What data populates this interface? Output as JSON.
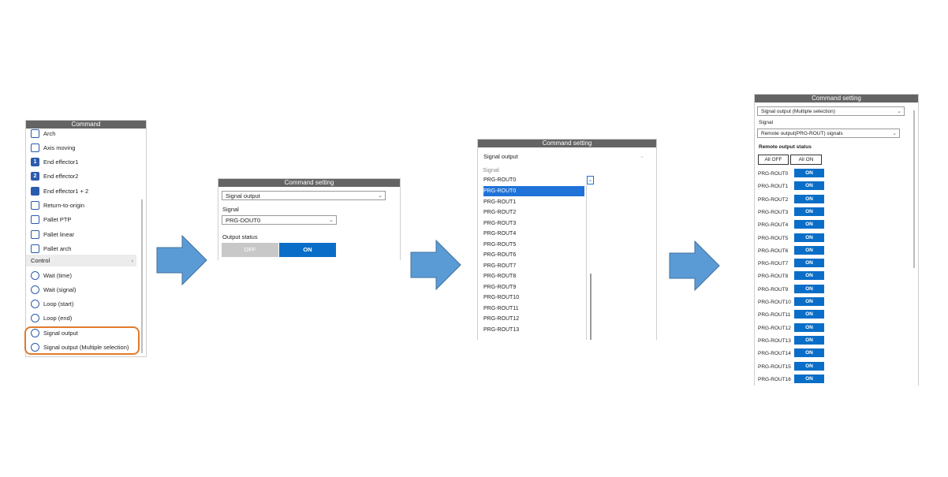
{
  "colors": {
    "accent": "#0a6ec8",
    "titlebar": "#646464",
    "arrow": "#5b9bd5",
    "highlight": "#e07b2c"
  },
  "panel1": {
    "title": "Command",
    "items": [
      {
        "label": "Arch",
        "icon": "arch-icon"
      },
      {
        "label": "Axis moving",
        "icon": "axis-moving-icon"
      },
      {
        "label": "End effector1",
        "icon": "end-effector-1-icon",
        "glyph": "1"
      },
      {
        "label": "End effector2",
        "icon": "end-effector-2-icon",
        "glyph": "2"
      },
      {
        "label": "End effector1 + 2",
        "icon": "end-effector-both-icon"
      },
      {
        "label": "Return-to-origin",
        "icon": "home-icon"
      },
      {
        "label": "Pallet PTP",
        "icon": "pallet-ptp-icon"
      },
      {
        "label": "Pallet linear",
        "icon": "pallet-linear-icon"
      },
      {
        "label": "Pallet arch",
        "icon": "pallet-arch-icon"
      }
    ],
    "section": "Control",
    "control_items": [
      {
        "label": "Wait (time)",
        "icon": "clock-icon"
      },
      {
        "label": "Wait (signal)",
        "icon": "signal-wait-icon"
      },
      {
        "label": "Loop (start)",
        "icon": "loop-start-icon"
      },
      {
        "label": "Loop (end)",
        "icon": "loop-end-icon"
      },
      {
        "label": "Signal output",
        "icon": "pulse-icon"
      },
      {
        "label": "Signal output (Multiple selection)",
        "icon": "multi-pulse-icon"
      }
    ]
  },
  "panel2": {
    "title": "Command setting",
    "command_value": "Signal output",
    "signal_label": "Signal",
    "signal_value": "PRG-DOUT0",
    "status_label": "Output status",
    "off_label": "OFF",
    "on_label": "ON"
  },
  "panel3": {
    "title": "Command setting",
    "command_value": "Signal output",
    "signal_label": "Signal",
    "current_value": "PRG-ROUT0",
    "options": [
      "PRG-ROUT0",
      "PRG-ROUT1",
      "PRG-ROUT2",
      "PRG-ROUT3",
      "PRG-ROUT4",
      "PRG-ROUT5",
      "PRG-ROUT6",
      "PRG-ROUT7",
      "PRG-ROUT8",
      "PRG-ROUT9",
      "PRG-ROUT10",
      "PRG-ROUT11",
      "PRG-ROUT12",
      "PRG-ROUT13"
    ]
  },
  "panel4": {
    "title": "Command setting",
    "command_value": "Signal output (Multiple selection)",
    "signal_label": "Signal",
    "signal_value": "Remote output(PRG-ROUT) signals",
    "status_label": "Remote output status",
    "all_off": "All OFF",
    "all_on": "All ON",
    "on_label": "ON",
    "rows": [
      "PRG-ROUT0",
      "PRG-ROUT1",
      "PRG-ROUT2",
      "PRG-ROUT3",
      "PRG-ROUT4",
      "PRG-ROUT5",
      "PRG-ROUT6",
      "PRG-ROUT7",
      "PRG-ROUT8",
      "PRG-ROUT9",
      "PRG-ROUT10",
      "PRG-ROUT11",
      "PRG-ROUT12",
      "PRG-ROUT13",
      "PRG-ROUT14",
      "PRG-ROUT15",
      "PRG-ROUT16"
    ]
  }
}
